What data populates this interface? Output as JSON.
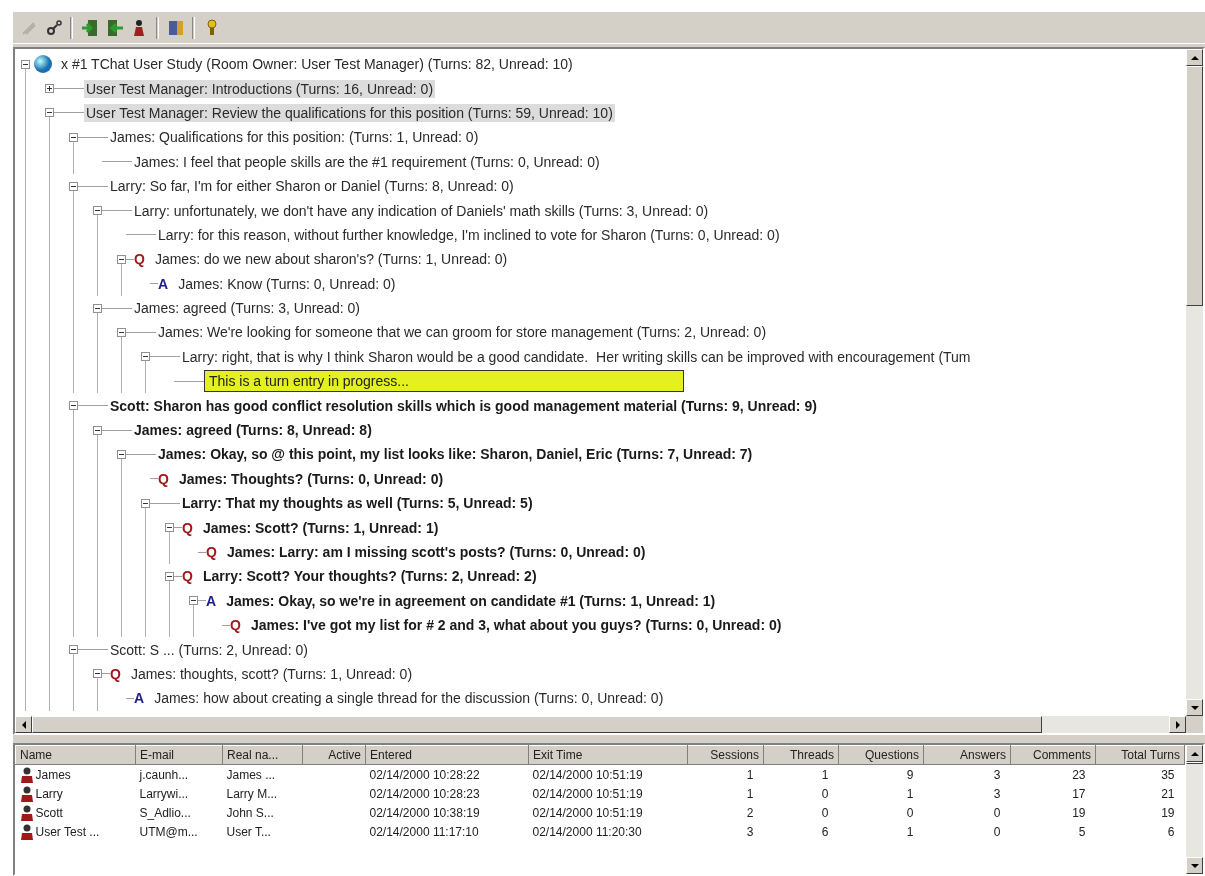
{
  "toolbar": {
    "buttons": [
      {
        "disabled": true
      },
      {
        "disabled": false
      },
      {
        "disabled": false
      },
      {
        "disabled": false
      },
      {
        "disabled": false
      },
      {
        "disabled": false
      },
      {
        "disabled": false
      }
    ]
  },
  "tree": {
    "nodes": [
      {
        "kind": "room",
        "text": "x #1 TChat User Study (Room Owner: User Test Manager) (Turns: 82, Unread: 10)",
        "unread": false,
        "highlighted": false,
        "expanded": true,
        "children": [
          {
            "kind": "post",
            "text": "User Test Manager: Introductions (Turns: 16, Unread: 0)",
            "unread": false,
            "highlighted": true,
            "expanded": false
          },
          {
            "kind": "post",
            "text": "User Test Manager: Review the qualifications for this position (Turns: 59, Unread: 10)",
            "unread": false,
            "highlighted": true,
            "expanded": true,
            "children": [
              {
                "kind": "post",
                "text": "James: Qualifications for this position: (Turns: 1, Unread: 0)",
                "unread": false,
                "highlighted": false,
                "expanded": true,
                "children": [
                  {
                    "kind": "post",
                    "text": "James: I feel that people skills are the #1 requirement (Turns: 0, Unread: 0)",
                    "unread": false,
                    "highlighted": false
                  }
                ]
              },
              {
                "kind": "post",
                "text": "Larry: So far, I'm for either Sharon or Daniel (Turns: 8, Unread: 0)",
                "unread": false,
                "highlighted": false,
                "expanded": true,
                "children": [
                  {
                    "kind": "post",
                    "text": "Larry: unfortunately, we don't have any indication of Daniels' math skills (Turns: 3, Unread: 0)",
                    "unread": false,
                    "highlighted": false,
                    "expanded": true,
                    "children": [
                      {
                        "kind": "post",
                        "text": "Larry: for this reason, without further knowledge, I'm inclined to vote for Sharon (Turns: 0, Unread: 0)",
                        "unread": false,
                        "highlighted": false
                      },
                      {
                        "kind": "question",
                        "marker": "Q",
                        "text": "James: do we new about sharon's? (Turns: 1, Unread: 0)",
                        "unread": false,
                        "highlighted": false,
                        "expanded": true,
                        "children": [
                          {
                            "kind": "answer",
                            "marker": "A",
                            "text": "James: Know (Turns: 0, Unread: 0)",
                            "unread": false,
                            "highlighted": false
                          }
                        ]
                      }
                    ]
                  },
                  {
                    "kind": "post",
                    "text": "James: agreed (Turns: 3, Unread: 0)",
                    "unread": false,
                    "highlighted": false,
                    "expanded": true,
                    "children": [
                      {
                        "kind": "post",
                        "text": "James: We're looking for someone that we can groom for store management (Turns: 2, Unread: 0)",
                        "unread": false,
                        "highlighted": false,
                        "expanded": true,
                        "children": [
                          {
                            "kind": "post",
                            "text": "Larry: right, that is why I think Sharon would be a good candidate.  Her writing skills can be improved with encouragement (Tum",
                            "unread": false,
                            "highlighted": false,
                            "expanded": true,
                            "children": [
                              {
                                "kind": "entry",
                                "value": "This is a turn entry in progress..."
                              }
                            ]
                          }
                        ]
                      }
                    ]
                  }
                ]
              },
              {
                "kind": "post",
                "text": "Scott: Sharon has good conflict resolution skills which is good management material (Turns: 9, Unread: 9)",
                "unread": true,
                "highlighted": false,
                "expanded": true,
                "children": [
                  {
                    "kind": "post",
                    "text": "James: agreed (Turns: 8, Unread: 8)",
                    "unread": true,
                    "highlighted": false,
                    "expanded": true,
                    "children": [
                      {
                        "kind": "post",
                        "text": "James: Okay, so @ this point, my list looks like: Sharon, Daniel, Eric (Turns: 7, Unread: 7)",
                        "unread": true,
                        "highlighted": false,
                        "expanded": true,
                        "children": [
                          {
                            "kind": "question",
                            "marker": "Q",
                            "text": "James: Thoughts? (Turns: 0, Unread: 0)",
                            "unread": true,
                            "highlighted": false
                          },
                          {
                            "kind": "post",
                            "text": "Larry: That my thoughts as well (Turns: 5, Unread: 5)",
                            "unread": true,
                            "highlighted": false,
                            "expanded": true,
                            "children": [
                              {
                                "kind": "question",
                                "marker": "Q",
                                "text": "James: Scott? (Turns: 1, Unread: 1)",
                                "unread": true,
                                "highlighted": false,
                                "expanded": true,
                                "children": [
                                  {
                                    "kind": "question",
                                    "marker": "Q",
                                    "text": "James: Larry: am I missing scott's posts? (Turns: 0, Unread: 0)",
                                    "unread": true,
                                    "highlighted": false
                                  }
                                ]
                              },
                              {
                                "kind": "question",
                                "marker": "Q",
                                "text": "Larry: Scott? Your thoughts? (Turns: 2, Unread: 2)",
                                "unread": true,
                                "highlighted": false,
                                "expanded": true,
                                "children": [
                                  {
                                    "kind": "answer",
                                    "marker": "A",
                                    "text": "James: Okay, so we're in agreement on candidate #1 (Turns: 1, Unread: 1)",
                                    "unread": true,
                                    "highlighted": false,
                                    "expanded": true,
                                    "children": [
                                      {
                                        "kind": "question",
                                        "marker": "Q",
                                        "text": "James: I've got my list for # 2 and 3, what about you guys? (Turns: 0, Unread: 0)",
                                        "unread": true,
                                        "highlighted": false
                                      }
                                    ]
                                  }
                                ]
                              }
                            ]
                          }
                        ]
                      }
                    ]
                  }
                ]
              },
              {
                "kind": "post",
                "text": "Scott: S ... (Turns: 2, Unread: 0)",
                "unread": false,
                "highlighted": false,
                "expanded": true,
                "children": [
                  {
                    "kind": "question",
                    "marker": "Q",
                    "text": "James: thoughts, scott? (Turns: 1, Unread: 0)",
                    "unread": false,
                    "highlighted": false,
                    "expanded": true,
                    "children": [
                      {
                        "kind": "answer",
                        "marker": "A",
                        "text": "James: how about creating a single thread for the discussion (Turns: 0, Unread: 0)",
                        "unread": false,
                        "highlighted": false
                      }
                    ]
                  }
                ]
              }
            ]
          }
        ]
      }
    ]
  },
  "users_table": {
    "columns": [
      "Name",
      "E-mail",
      "Real na...",
      "Active",
      "Entered",
      "Exit Time",
      "Sessions",
      "Threads",
      "Questions",
      "Answers",
      "Comments",
      "Total Turns"
    ],
    "rows": [
      {
        "name": "James",
        "email": "j.caunh...",
        "real_name": "James ...",
        "entered": "02/14/2000 10:28:22",
        "exit_time": "02/14/2000 10:51:19",
        "sessions": "1",
        "threads": "1",
        "questions": "9",
        "answers": "3",
        "comments": "23",
        "total_turns": "35"
      },
      {
        "name": "Larry",
        "email": "Larrywi...",
        "real_name": "Larry M...",
        "entered": "02/14/2000 10:28:23",
        "exit_time": "02/14/2000 10:51:19",
        "sessions": "1",
        "threads": "0",
        "questions": "1",
        "answers": "3",
        "comments": "17",
        "total_turns": "21"
      },
      {
        "name": "Scott",
        "email": "S_Adlio...",
        "real_name": "John S...",
        "entered": "02/14/2000 10:38:19",
        "exit_time": "02/14/2000 10:51:19",
        "sessions": "2",
        "threads": "0",
        "questions": "0",
        "answers": "0",
        "comments": "19",
        "total_turns": "19"
      },
      {
        "name": "User Test ...",
        "email": "UTM@m...",
        "real_name": "User T...",
        "entered": "02/14/2000 11:17:10",
        "exit_time": "02/14/2000 11:20:30",
        "sessions": "3",
        "threads": "6",
        "questions": "1",
        "answers": "0",
        "comments": "5",
        "total_turns": "6"
      }
    ]
  }
}
